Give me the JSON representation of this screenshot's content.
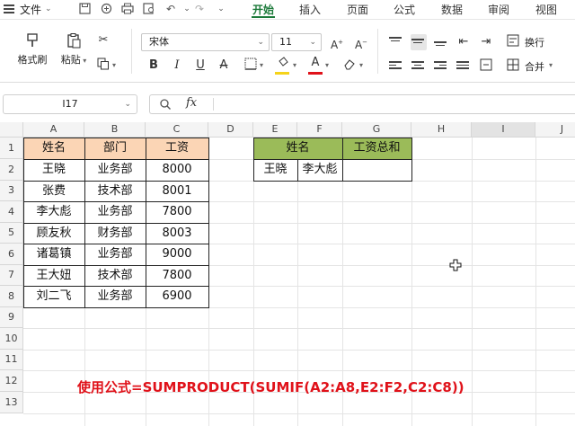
{
  "menubar": {
    "file": "文件",
    "tabs": [
      "开始",
      "插入",
      "页面",
      "公式",
      "数据",
      "审阅",
      "视图"
    ],
    "active_tab": "开始"
  },
  "ribbon": {
    "format_painter": "格式刷",
    "paste": "粘贴",
    "font_name": "宋体",
    "font_size": "11",
    "wrap_text": "换行",
    "merge": "合并",
    "colors": {
      "highlight": "#f5d31a",
      "font": "#e0121a"
    }
  },
  "formula_bar": {
    "cell_ref": "I17",
    "fx_label": "fx",
    "formula": ""
  },
  "grid": {
    "columns": [
      "A",
      "B",
      "C",
      "D",
      "E",
      "F",
      "G",
      "H",
      "I",
      "J"
    ],
    "selected_column": "I",
    "rows": [
      "1",
      "2",
      "3",
      "4",
      "5",
      "6",
      "7",
      "8",
      "9",
      "10",
      "11",
      "12",
      "13"
    ],
    "table1": {
      "headers": [
        "姓名",
        "部门",
        "工资"
      ],
      "header_fill": "#fbd5b5",
      "rows": [
        [
          "王晓",
          "业务部",
          "8000"
        ],
        [
          "张费",
          "技术部",
          "8001"
        ],
        [
          "李大彪",
          "业务部",
          "7800"
        ],
        [
          "顾友秋",
          "财务部",
          "8003"
        ],
        [
          "诸葛镇",
          "业务部",
          "9000"
        ],
        [
          "王大妞",
          "技术部",
          "7800"
        ],
        [
          "刘二飞",
          "业务部",
          "6900"
        ]
      ]
    },
    "table2": {
      "headers": [
        "姓名",
        "工资总和"
      ],
      "header_fill": "#9bbb59",
      "names": [
        "王晓",
        "李大彪"
      ],
      "total": ""
    },
    "note": "使用公式=SUMPRODUCT(SUMIF(A2:A8,E2:F2,C2:C8))"
  }
}
